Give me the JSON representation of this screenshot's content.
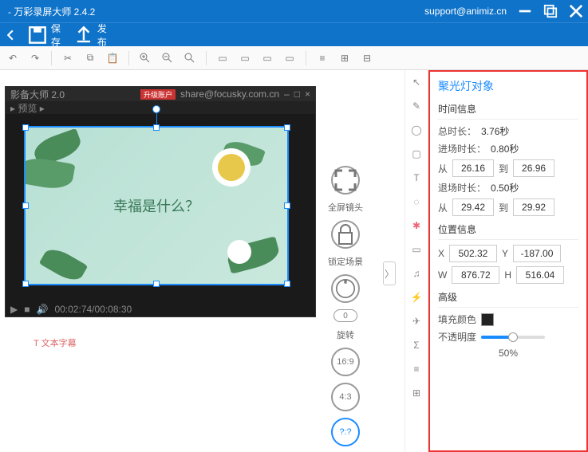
{
  "titlebar": {
    "title": "- 万彩录屏大师 2.4.2",
    "support": "support@animiz.cn"
  },
  "menubar": {
    "save": "保存",
    "publish": "发布"
  },
  "canvas": {
    "darkTitle": "影备大师 2.0",
    "darkUrl": "share@focusky.com.cn",
    "darkBadge": "升级账户",
    "centerText": "幸福是什么？",
    "timecode": "00:02:74/00:08:30",
    "txtLink": "T 文本字幕"
  },
  "floating": {
    "fullscreen": "全屏镜头",
    "lock": "锁定场景",
    "rotate": "旋转",
    "rotVal": "0",
    "ratio1": "16:9",
    "ratio2": "4:3",
    "ratio3": "?:?"
  },
  "panel": {
    "title": "聚光灯对象",
    "sec1": "时间信息",
    "totalDurLabel": "总时长：",
    "totalDur": "3.76秒",
    "enterDurLabel": "进场时长：",
    "enterDur": "0.80秒",
    "fromLabel": "从",
    "toLabel": "到",
    "t1from": "26.16",
    "t1to": "26.96",
    "exitDurLabel": "退场时长：",
    "exitDur": "0.50秒",
    "t2from": "29.42",
    "t2to": "29.92",
    "sec2": "位置信息",
    "xLabel": "X",
    "yLabel": "Y",
    "wLabel": "W",
    "hLabel": "H",
    "x": "502.32",
    "y": "-187.00",
    "w": "876.72",
    "h": "516.04",
    "sec3": "高级",
    "fillLabel": "填充颜色",
    "opacityLabel": "不透明度",
    "opacityPct": "50%"
  }
}
